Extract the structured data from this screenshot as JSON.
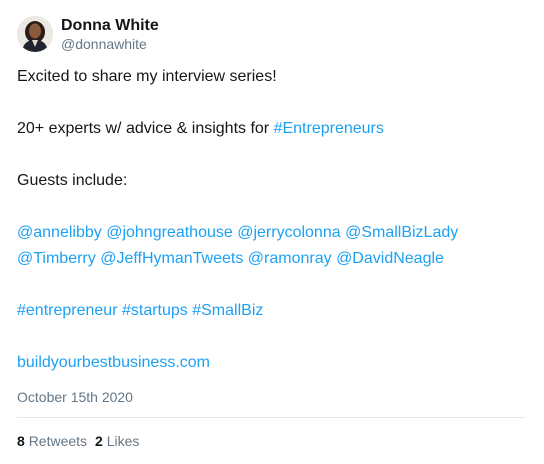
{
  "author": {
    "display_name": "Donna White",
    "handle": "@donnawhite",
    "avatar_icon": "profile-photo"
  },
  "body": {
    "line1": "Excited to share my interview series!",
    "line2_text": "20+ experts w/ advice & insights for ",
    "line2_hashtag": "#Entrepreneurs",
    "line3": "Guests include:",
    "mentions_row1": [
      "@annelibby",
      "@johngreathouse",
      "@jerrycolonna",
      "@SmallBizLady"
    ],
    "mentions_row2": [
      "@Timberry",
      "@JeffHymanTweets",
      "@ramonray",
      "@DavidNeagle"
    ],
    "hashtags": [
      "#entrepreneur",
      "#startups",
      "#SmallBiz"
    ],
    "url": "buildyourbestbusiness.com"
  },
  "date": "October 15th 2020",
  "stats": {
    "retweets_count": "8",
    "retweets_label": "Retweets",
    "likes_count": "2",
    "likes_label": "Likes"
  },
  "colors": {
    "link": "#1da1f2",
    "text": "#14171a",
    "muted": "#657786",
    "divider": "#e1e8ed"
  }
}
